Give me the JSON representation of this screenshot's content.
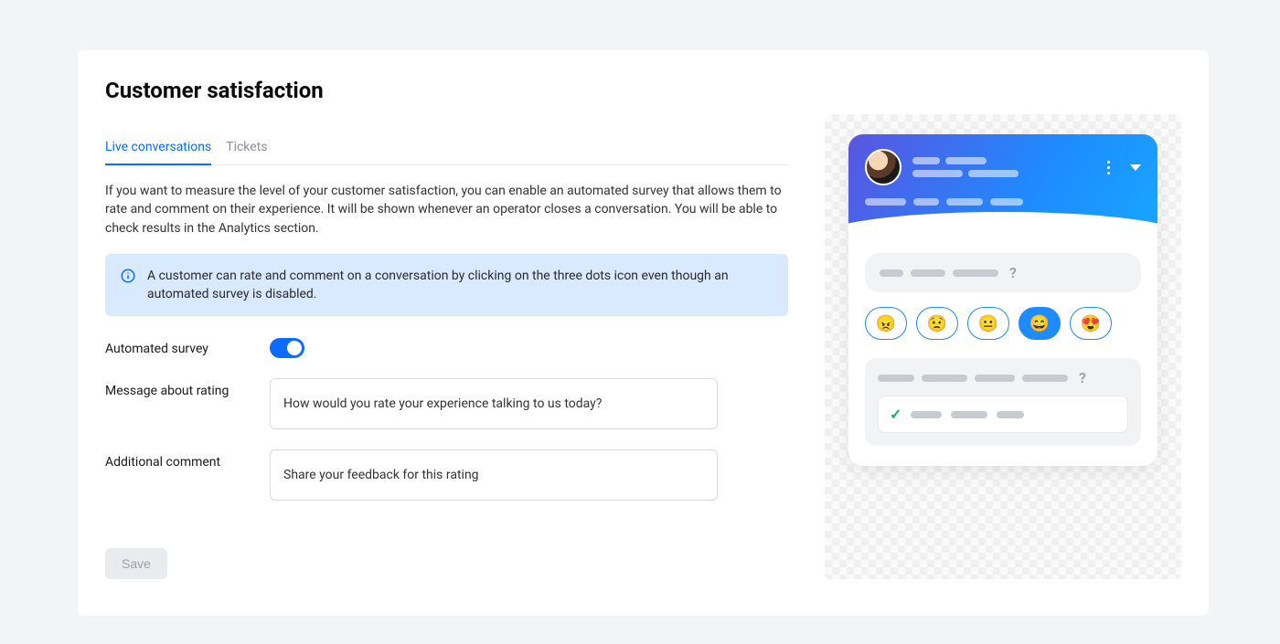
{
  "page": {
    "title": "Customer satisfaction"
  },
  "tabs": {
    "live": "Live conversations",
    "tickets": "Tickets"
  },
  "intro": "If you want to measure the level of your customer satisfaction, you can enable an automated survey that allows them to rate and comment on their experience. It will be shown whenever an operator closes a conversation. You will be able to check results in the Analytics section.",
  "infobox": "A customer can rate and comment on a conversation by clicking on the three dots icon even though an automated survey is disabled.",
  "labels": {
    "automated_survey": "Automated survey",
    "message_rating": "Message about rating",
    "additional_comment": "Additional comment"
  },
  "values": {
    "automated_survey_on": true,
    "message_rating": "How would you rate your experience talking to us today?",
    "additional_comment": "Share your feedback for this rating"
  },
  "buttons": {
    "save": "Save"
  },
  "preview": {
    "emojis": [
      "😠",
      "😟",
      "😐",
      "😄",
      "😍"
    ],
    "selected_index": 3,
    "question_mark": "?"
  }
}
